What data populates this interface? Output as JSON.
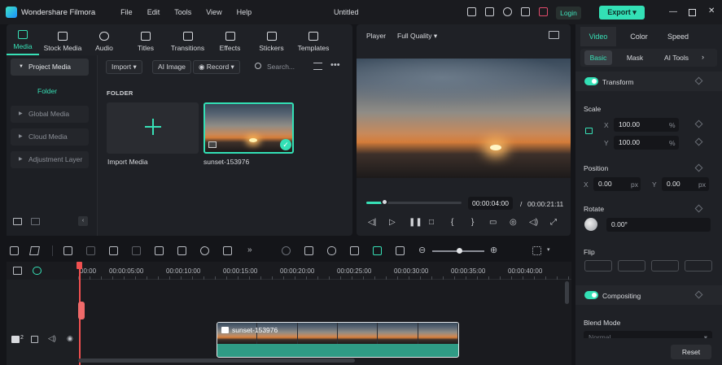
{
  "app": {
    "name": "Wondershare Filmora",
    "doc_title": "Untitled"
  },
  "menu": [
    "File",
    "Edit",
    "Tools",
    "View",
    "Help"
  ],
  "header": {
    "login_label": "Login",
    "export_label": "Export"
  },
  "media_tabs": [
    {
      "label": "Media",
      "icon": "media-icon"
    },
    {
      "label": "Stock Media",
      "icon": "stock-media-icon"
    },
    {
      "label": "Audio",
      "icon": "music-note-icon"
    },
    {
      "label": "Titles",
      "icon": "text-t-icon"
    },
    {
      "label": "Transitions",
      "icon": "transitions-icon"
    },
    {
      "label": "Effects",
      "icon": "effects-icon"
    },
    {
      "label": "Stickers",
      "icon": "sticker-icon"
    },
    {
      "label": "Templates",
      "icon": "templates-icon"
    }
  ],
  "sidebar": {
    "project_media": "Project Media",
    "folder": "Folder",
    "items": [
      "Global Media",
      "Cloud Media",
      "Adjustment Layer"
    ]
  },
  "media_toolbar": {
    "import": "Import",
    "ai_image": "AI Image",
    "record": "Record",
    "search_placeholder": "Search..."
  },
  "folder_section": "FOLDER",
  "cards": {
    "import_label": "Import Media",
    "clip_label": "sunset-153976"
  },
  "player": {
    "label": "Player",
    "quality": "Full Quality",
    "current_time": "00:00:04:00",
    "separator": "/",
    "total_time": "00:00:21:11",
    "progress": 0.19
  },
  "props": {
    "tabs": [
      "Video",
      "Color",
      "Speed"
    ],
    "sub_tabs": [
      "Basic",
      "Mask",
      "AI Tools"
    ],
    "transform": "Transform",
    "scale": {
      "label": "Scale",
      "x_axis": "X",
      "x": "100.00",
      "y_axis": "Y",
      "y": "100.00",
      "unit": "%"
    },
    "position": {
      "label": "Position",
      "x_axis": "X",
      "x": "0.00",
      "y_axis": "Y",
      "y": "0.00",
      "unit": "px"
    },
    "rotate": {
      "label": "Rotate",
      "value": "0.00°"
    },
    "flip": "Flip",
    "compositing": "Compositing",
    "blend_mode": {
      "label": "Blend Mode",
      "value": "Normal"
    },
    "reset": "Reset"
  },
  "timeline": {
    "ruler": [
      "00:00",
      "00:00:05:00",
      "00:00:10:00",
      "00:00:15:00",
      "00:00:20:00",
      "00:00:25:00",
      "00:00:30:00",
      "00:00:35:00",
      "00:00:40:00"
    ],
    "clip_name": "sunset-153976",
    "track_number": "2"
  },
  "colors": {
    "accent": "#33e0b5",
    "playhead": "#f05050",
    "panel": "#1f2126",
    "background": "#141519"
  }
}
